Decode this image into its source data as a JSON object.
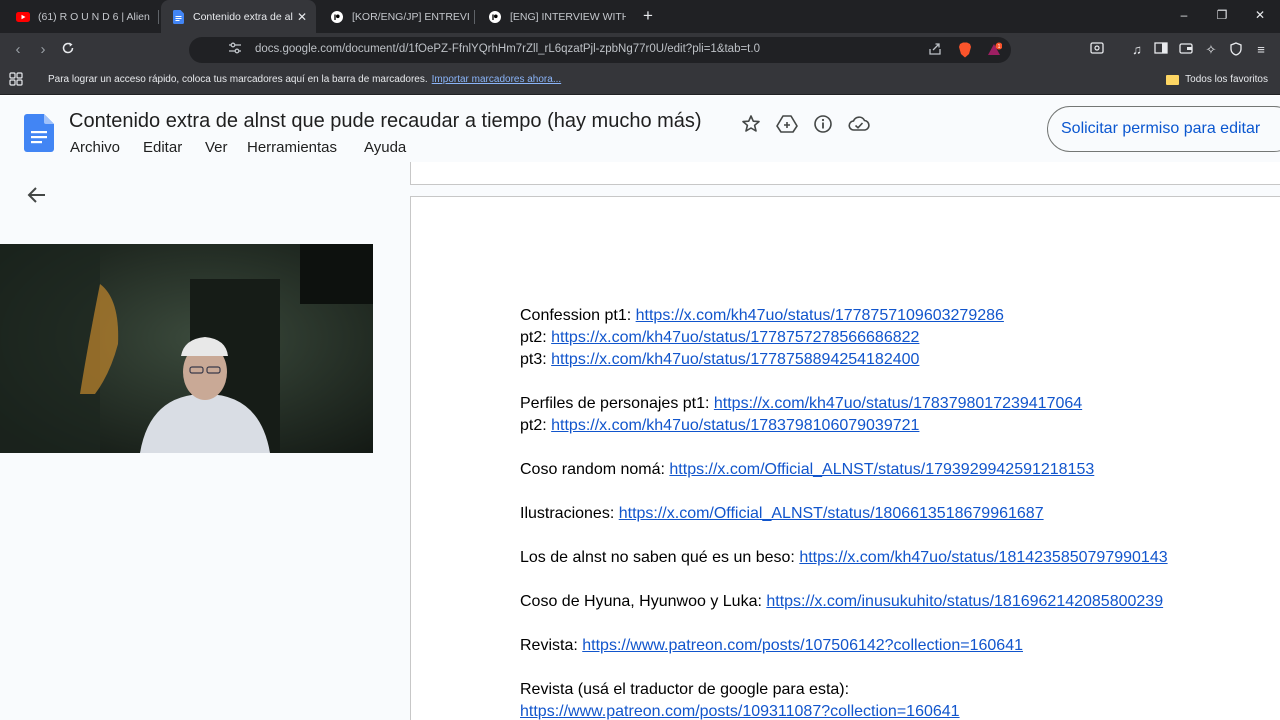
{
  "browser": {
    "tabs": [
      {
        "label": "(61) R O U N D 6 | Alien",
        "favicon": "youtube-icon",
        "active": false
      },
      {
        "label": "Contenido extra de al",
        "favicon": "google-docs-icon",
        "active": true
      },
      {
        "label": "[KOR/ENG/JP] ENTREVIST",
        "favicon": "patreon-icon",
        "active": false
      },
      {
        "label": "[ENG] INTERVIEW WITH LI",
        "favicon": "patreon-icon",
        "active": false
      }
    ],
    "url": "docs.google.com/document/d/1fOePZ-FfnlYQrhHm7rZll_rL6qzatPjl-zpbNg77r0U/edit?pli=1&tab=t.0",
    "bookmarks_bar": {
      "prompt": "Para lograr un acceso rápido, coloca tus marcadores aquí en la barra de marcadores.",
      "import_link": "Importar marcadores ahora...",
      "all_favorites": "Todos los favoritos"
    },
    "extension_badge": "1"
  },
  "docs": {
    "title": "Contenido extra de alnst que pude recaudar a tiempo (hay mucho más)",
    "menu": [
      "Archivo",
      "Editar",
      "Ver",
      "Herramientas",
      "Ayuda"
    ],
    "request_edit_label": "Solicitar permiso para editar"
  },
  "document": {
    "lines": [
      {
        "label": "Confession pt1: ",
        "link": "https://x.com/kh47uo/status/1778757109603279286"
      },
      {
        "label": "pt2: ",
        "link": "https://x.com/kh47uo/status/1778757278566686822"
      },
      {
        "label": "pt3: ",
        "link": "https://x.com/kh47uo/status/1778758894254182400"
      },
      {
        "label": "Perfiles de personajes pt1: ",
        "link": "https://x.com/kh47uo/status/1783798017239417064"
      },
      {
        "label": "pt2: ",
        "link": "https://x.com/kh47uo/status/1783798106079039721"
      },
      {
        "label": "Coso random nomá: ",
        "link": "https://x.com/Official_ALNST/status/1793929942591218153"
      },
      {
        "label": "Ilustraciones: ",
        "link": "https://x.com/Official_ALNST/status/1806613518679961687"
      },
      {
        "label": "Los de alnst no saben qué es un beso: ",
        "link": "https://x.com/kh47uo/status/1814235850797990143"
      },
      {
        "label": "Coso de Hyuna, Hyunwoo y Luka: ",
        "link": "https://x.com/inusukuhito/status/1816962142085800239"
      },
      {
        "label": "Revista: ",
        "link": "https://www.patreon.com/posts/107506142?collection=160641"
      },
      {
        "label": "Revista (usá el traductor de google para esta): ",
        "link": ""
      },
      {
        "label": "",
        "link": "https://www.patreon.com/posts/109311087?collection=160641"
      }
    ]
  },
  "colors": {
    "tab_bg": "#202124",
    "toolbar_bg": "#35363a",
    "docs_header_bg": "#f9fbfd",
    "link": "#1155cc",
    "docs_blue": "#4285f4",
    "primary_button_text": "#0b57d0"
  }
}
